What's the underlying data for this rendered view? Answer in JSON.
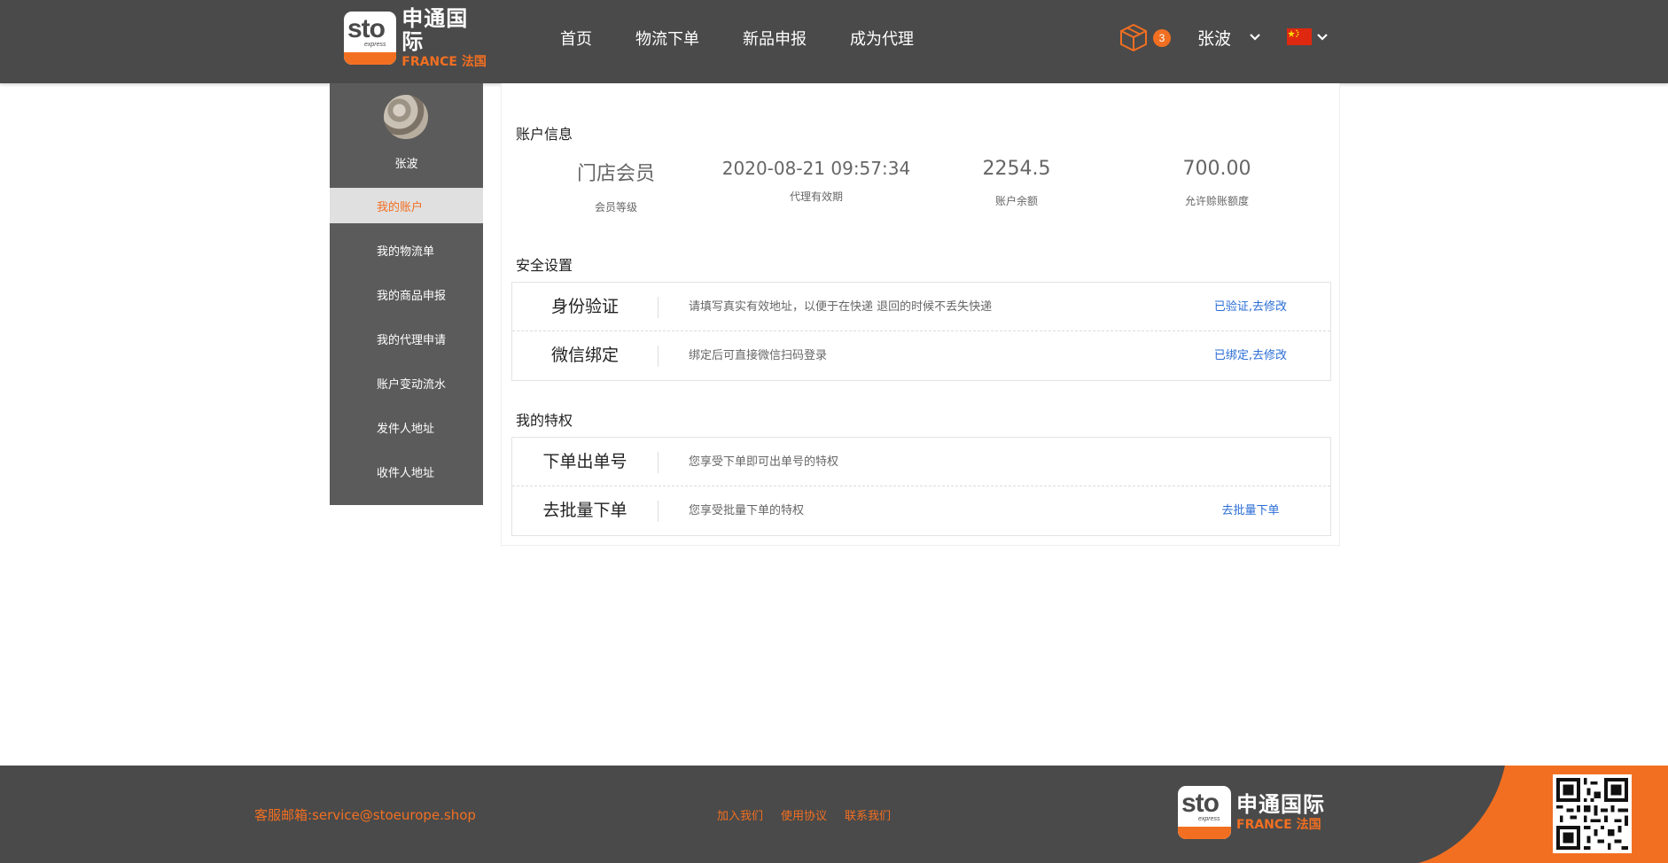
{
  "brand": {
    "logo_mark": "sto",
    "logo_sub": "express",
    "name_cn": "申通国际",
    "name_fr": "FRANCE 法国"
  },
  "nav": {
    "items": [
      "首页",
      "物流下单",
      "新品申报",
      "成为代理"
    ]
  },
  "header": {
    "cart_icon": "package-box-icon",
    "cart_count": "3",
    "user_name": "张波",
    "language_flag": "china-flag-icon",
    "accent_color": "#f26f21"
  },
  "sidebar": {
    "user_name": "张波",
    "items": [
      {
        "label": "我的账户",
        "active": true
      },
      {
        "label": "我的物流单",
        "active": false
      },
      {
        "label": "我的商品申报",
        "active": false
      },
      {
        "label": "我的代理申请",
        "active": false
      },
      {
        "label": "账户变动流水",
        "active": false
      },
      {
        "label": "发件人地址",
        "active": false
      },
      {
        "label": "收件人地址",
        "active": false
      }
    ]
  },
  "account": {
    "title": "账户信息",
    "fields": [
      {
        "value": "门店会员",
        "label": "会员等级"
      },
      {
        "value": "2020-08-21 09:57:34",
        "label": "代理有效期"
      },
      {
        "value": "2254.5",
        "label": "账户余额"
      },
      {
        "value": "700.00",
        "label": "允许赊账额度"
      }
    ]
  },
  "security": {
    "title": "安全设置",
    "rows": [
      {
        "label": "身份验证",
        "desc": "请填写真实有效地址，以便于在快递 退回的时候不丢失快递",
        "action": "已验证,去修改"
      },
      {
        "label": "微信绑定",
        "desc": "绑定后可直接微信扫码登录",
        "action": "已绑定,去修改"
      }
    ]
  },
  "privileges": {
    "title": "我的特权",
    "rows": [
      {
        "label": "下单出单号",
        "desc": "您享受下单即可出单号的特权",
        "action": ""
      },
      {
        "label": "去批量下单",
        "desc": "您享受批量下单的特权",
        "action": "去批量下单"
      }
    ]
  },
  "footer": {
    "email": "客服邮箱:service@stoeurope.shop",
    "links": [
      "加入我们",
      "使用协议",
      "联系我们"
    ],
    "qr_icon": "qr-code-icon"
  }
}
